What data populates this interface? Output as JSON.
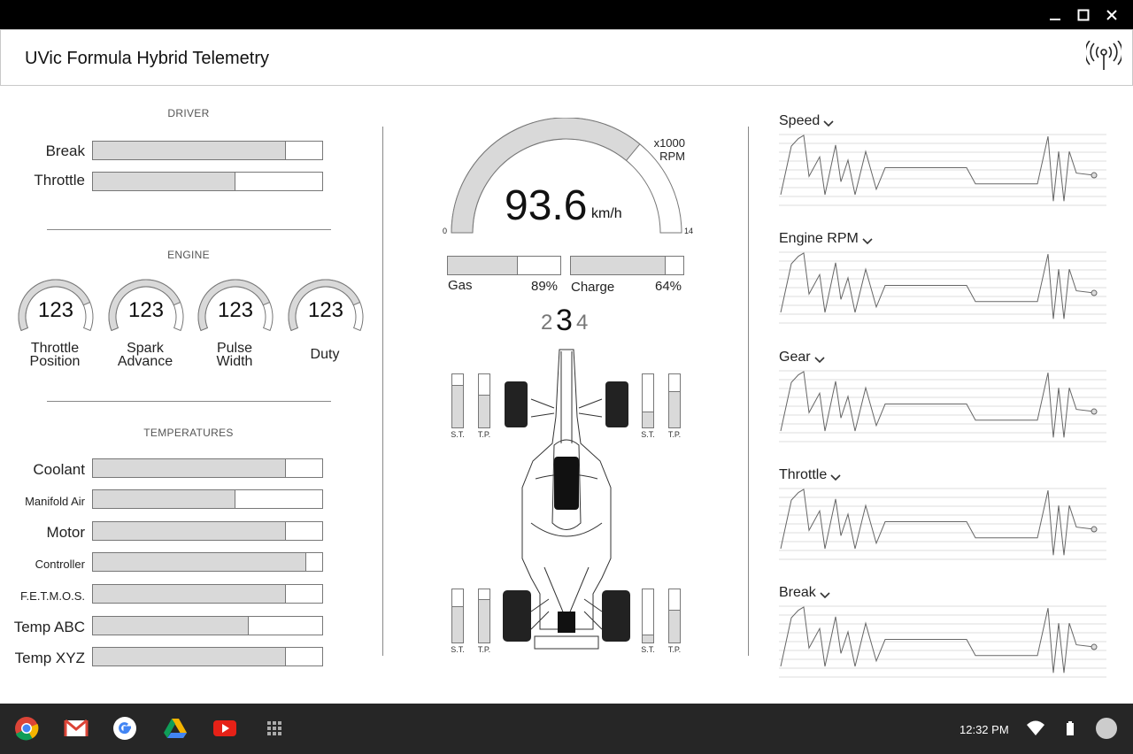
{
  "window": {
    "minimize_icon": "minimize-icon",
    "maximize_icon": "maximize-icon",
    "close_icon": "close-icon"
  },
  "header": {
    "title": "UVic Formula Hybrid Telemetry",
    "icon": "signal-tower-icon"
  },
  "driver": {
    "section_title": "DRIVER",
    "rows": [
      {
        "label": "Break",
        "fill": 0.84
      },
      {
        "label": "Throttle",
        "fill": 0.62
      }
    ]
  },
  "engine": {
    "section_title": "ENGINE",
    "gauges": [
      {
        "value": "123",
        "label_line1": "Throttle",
        "label_line2": "Position",
        "fill": 0.8
      },
      {
        "value": "123",
        "label_line1": "Spark",
        "label_line2": "Advance",
        "fill": 0.8
      },
      {
        "value": "123",
        "label_line1": "Pulse",
        "label_line2": "Width",
        "fill": 0.8
      },
      {
        "value": "123",
        "label_line1": "Duty",
        "label_line2": "",
        "fill": 0.8
      }
    ]
  },
  "temperatures": {
    "section_title": "TEMPERATURES",
    "rows": [
      {
        "label": "Coolant",
        "fill": 0.84,
        "small": false
      },
      {
        "label": "Manifold Air",
        "fill": 0.62,
        "small": true
      },
      {
        "label": "Motor",
        "fill": 0.84,
        "small": false
      },
      {
        "label": "Controller",
        "fill": 0.93,
        "small": true
      },
      {
        "label": "F.E.T.M.O.S.",
        "fill": 0.84,
        "small": true
      },
      {
        "label": "Temp ABC",
        "fill": 0.68,
        "small": false
      },
      {
        "label": "Temp XYZ",
        "fill": 0.84,
        "small": false
      }
    ]
  },
  "speedometer": {
    "value": "93.6",
    "unit": "km/h",
    "rpm_label_1": "x1000",
    "rpm_label_2": "RPM",
    "min": "0",
    "max": "14",
    "fill": 0.72
  },
  "fuel": {
    "gas_label": "Gas",
    "gas_value": "89%",
    "gas_fill": 0.62,
    "charge_label": "Charge",
    "charge_value": "64%",
    "charge_fill": 0.84
  },
  "gear": {
    "prev": "2",
    "current": "3",
    "next": "4"
  },
  "suspension": {
    "st_label": "S.T.",
    "tp_label": "T.P.",
    "front_left": {
      "st": 0.8,
      "tp": 0.62
    },
    "front_right": {
      "st": 0.3,
      "tp": 0.68
    },
    "rear_left": {
      "st": 0.68,
      "tp": 0.82
    },
    "rear_right": {
      "st": 0.15,
      "tp": 0.62
    }
  },
  "charts": [
    {
      "title": "Speed"
    },
    {
      "title": "Engine RPM"
    },
    {
      "title": "Gear"
    },
    {
      "title": "Throttle"
    },
    {
      "title": "Break"
    }
  ],
  "chart_series": [
    0,
    45,
    52,
    55,
    17,
    35,
    0,
    46,
    12,
    32,
    0,
    40,
    5,
    25,
    25,
    25,
    25,
    25,
    25,
    10,
    10,
    10,
    10,
    10,
    54,
    -6,
    40,
    -6,
    40,
    20,
    18
  ],
  "taskbar": {
    "apps": [
      "chrome-icon",
      "gmail-icon",
      "google-icon",
      "drive-icon",
      "youtube-icon",
      "app-launcher-icon"
    ],
    "time": "12:32 PM",
    "wifi_icon": "wifi-icon",
    "battery_icon": "battery-icon",
    "account_icon": "account-avatar"
  }
}
